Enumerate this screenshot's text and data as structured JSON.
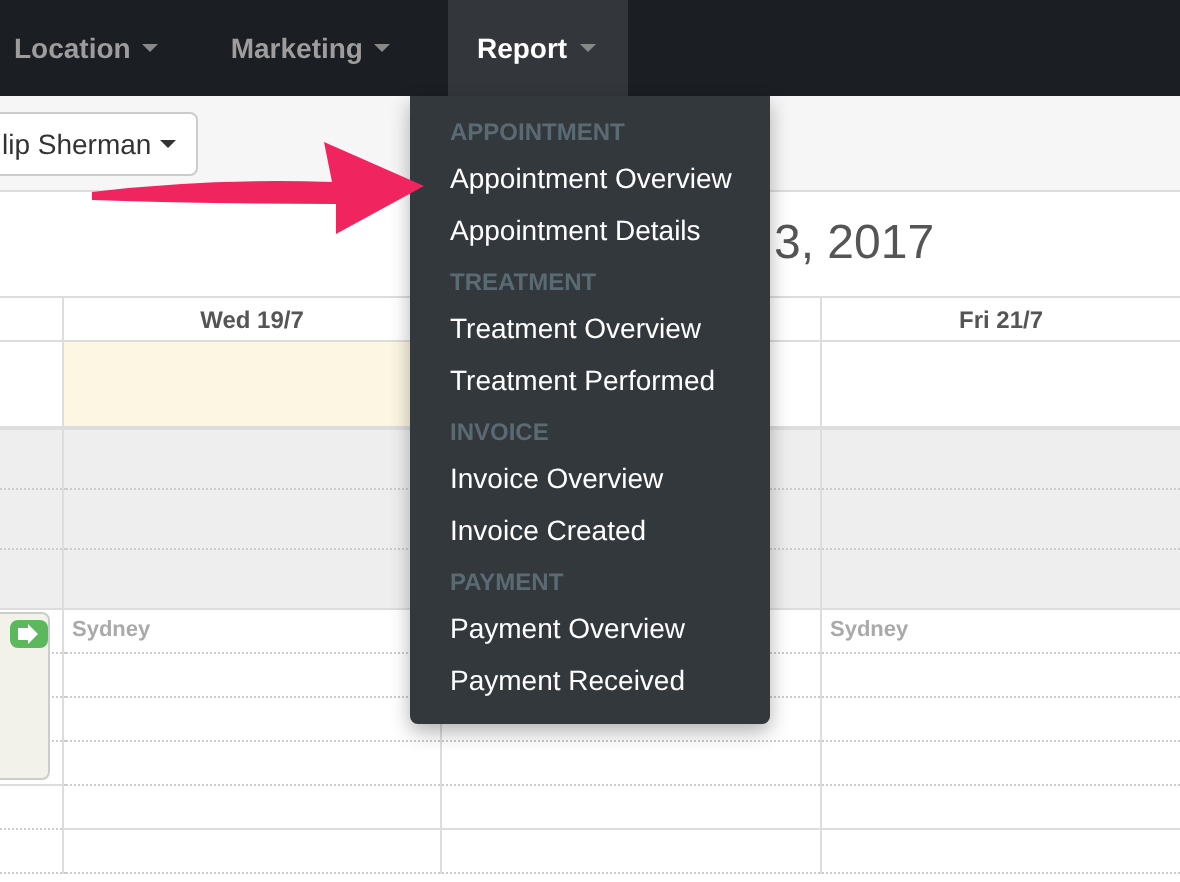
{
  "navbar": {
    "items": [
      {
        "label": "Location",
        "selected": false
      },
      {
        "label": "Marketing",
        "selected": false
      },
      {
        "label": "Report",
        "selected": true
      }
    ]
  },
  "report_menu": {
    "sections": [
      {
        "header": "APPOINTMENT",
        "items": [
          "Appointment Overview",
          "Appointment Details"
        ]
      },
      {
        "header": "TREATMENT",
        "items": [
          "Treatment Overview",
          "Treatment Performed"
        ]
      },
      {
        "header": "INVOICE",
        "items": [
          "Invoice Overview",
          "Invoice Created"
        ]
      },
      {
        "header": "PAYMENT",
        "items": [
          "Payment Overview",
          "Payment Received"
        ]
      }
    ]
  },
  "staff_button": {
    "label": "lip Sherman"
  },
  "calendar": {
    "title": "3, 2017",
    "columns": [
      {
        "header": "Wed 19/7",
        "today": true,
        "location": "Sydney"
      },
      {
        "today": false
      },
      {
        "header": "Fri 21/7",
        "today": false,
        "location": "Sydney"
      }
    ]
  }
}
